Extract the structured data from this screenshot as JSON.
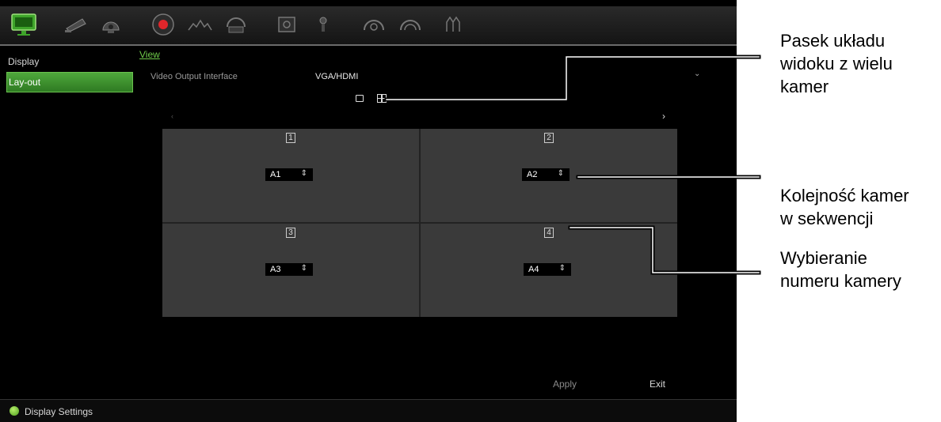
{
  "sidebar": {
    "items": [
      {
        "label": "Display"
      },
      {
        "label": "Lay-out"
      }
    ]
  },
  "main": {
    "tab_label": "View",
    "output_label": "Video Output Interface",
    "output_value": "VGA/HDMI",
    "dropdown_chevron": "⌄",
    "nav_left": "‹",
    "nav_right": "›"
  },
  "grid": {
    "cells": [
      {
        "number": "1",
        "camera": "A1"
      },
      {
        "number": "2",
        "camera": "A2"
      },
      {
        "number": "3",
        "camera": "A3"
      },
      {
        "number": "4",
        "camera": "A4"
      }
    ],
    "spinner_glyph": "⇕"
  },
  "buttons": {
    "apply": "Apply",
    "exit": "Exit"
  },
  "status": {
    "text": "Display Settings"
  },
  "callouts": {
    "layout_bar": "Pasek układu\nwidoku z wielu\nkamer",
    "sequence": "Kolejność kamer\nw sekwencji",
    "select": "Wybieranie\nnumeru kamery"
  },
  "colors": {
    "accent": "#4fa83c",
    "tab_link": "#6fcc4a",
    "record": "#e0262b"
  },
  "icons": [
    "monitor-icon",
    "camera-icon",
    "ptz-icon",
    "record-icon",
    "alarm-icon",
    "network-icon",
    "storage-icon",
    "device-icon",
    "system-icon",
    "user-icon",
    "shutdown-icon"
  ]
}
